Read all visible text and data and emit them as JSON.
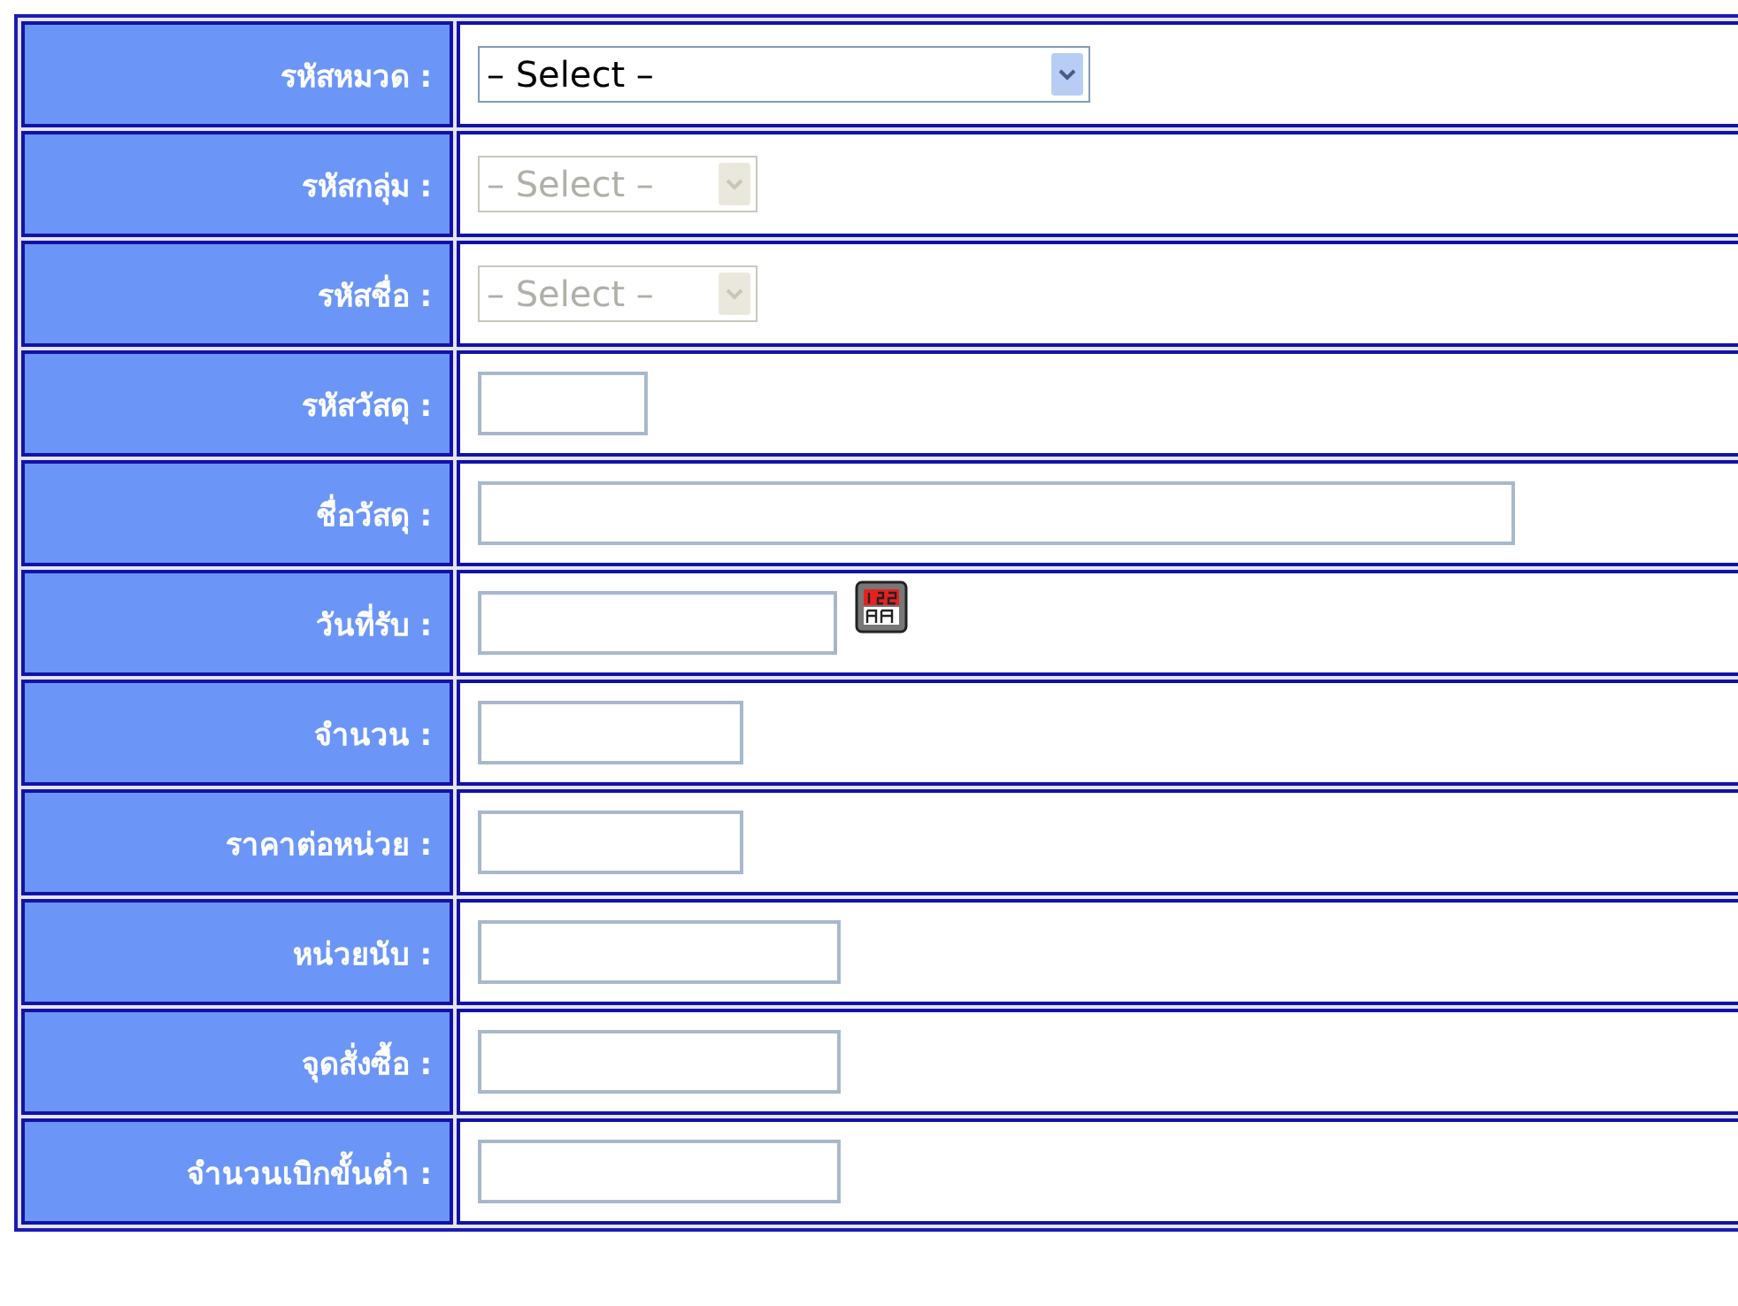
{
  "form": {
    "rows": [
      {
        "label": "รหัสหมวด :",
        "field": {
          "kind": "select",
          "value": "– Select –",
          "disabled": false
        }
      },
      {
        "label": "รหัสกลุ่ม :",
        "field": {
          "kind": "select",
          "value": "– Select –",
          "disabled": true
        }
      },
      {
        "label": "รหัสชื่อ :",
        "field": {
          "kind": "select",
          "value": "– Select –",
          "disabled": true
        }
      },
      {
        "label": "รหัสวัสดุ :",
        "field": {
          "kind": "text"
        }
      },
      {
        "label": "ชื่อวัสดุ :",
        "field": {
          "kind": "text"
        }
      },
      {
        "label": "วันที่รับ :",
        "field": {
          "kind": "date"
        }
      },
      {
        "label": "จำนวน :",
        "field": {
          "kind": "text"
        }
      },
      {
        "label": "ราคาต่อหน่วย :",
        "field": {
          "kind": "text"
        }
      },
      {
        "label": "หน่วยนับ :",
        "field": {
          "kind": "text"
        }
      },
      {
        "label": "จุดสั่งซื้อ :",
        "field": {
          "kind": "text"
        }
      },
      {
        "label": "จำนวนเบิกขั้นต่ำ :",
        "field": {
          "kind": "text"
        }
      }
    ]
  }
}
